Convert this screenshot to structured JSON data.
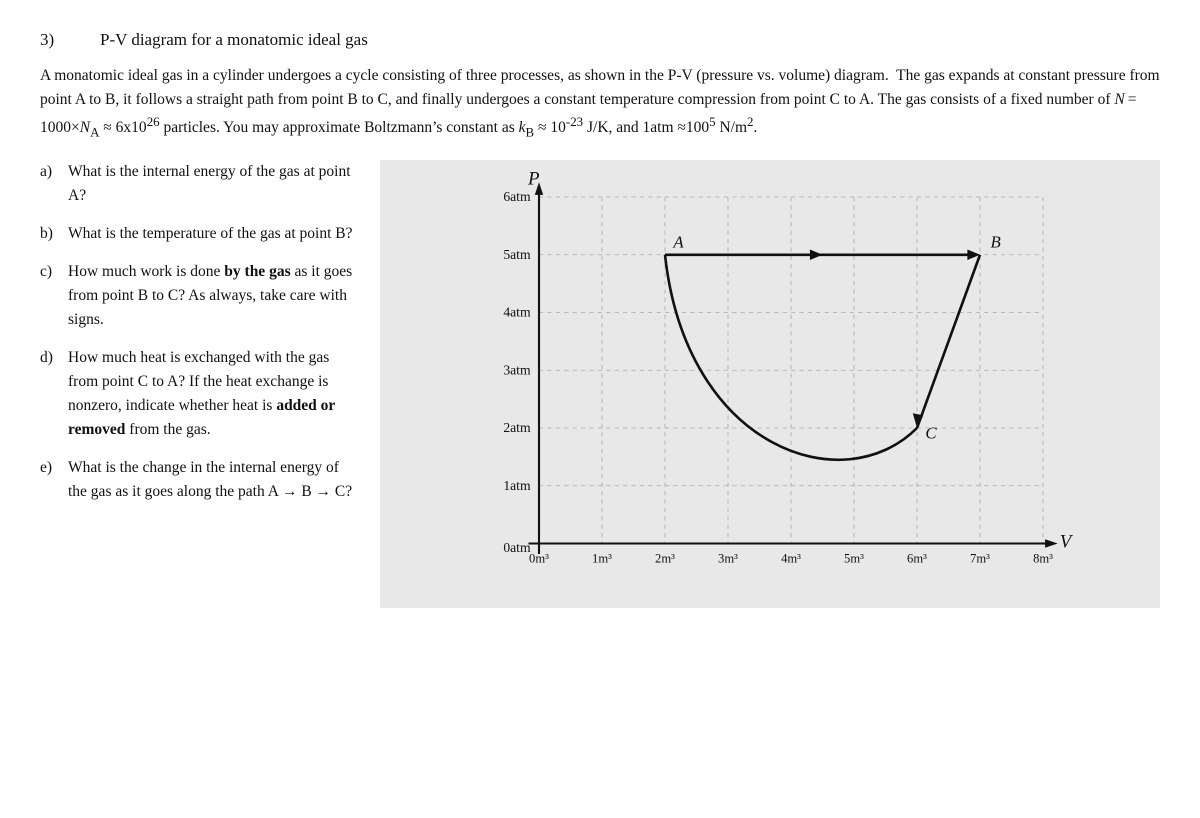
{
  "problem": {
    "number": "3)",
    "title": "P-V diagram for a monatomic ideal gas",
    "intro": "A monatomic ideal gas in a cylinder undergoes a cycle consisting of three processes, as shown in the P-V (pressure vs. volume) diagram.  The gas expands at constant pressure from point A to B, it follows a straight path from point B to C, and finally undergoes a constant temperature compression from point C to A. The gas consists of a fixed number of N = 1000×Nₐ ≈ 6x10²⁶ particles. You may approximate Boltzmann’s constant as kʙ ≈ 10⁻²³ J/K, and 1atm ≈100⁵ N/m².",
    "questions": [
      {
        "label": "a)",
        "text": "What is the internal energy of the gas at point A?"
      },
      {
        "label": "b)",
        "text": "What is the temperature of the gas at point B?"
      },
      {
        "label": "c)",
        "text": "How much work is done",
        "bold_part": "by the gas",
        "text2": "as it goes from point B to C? As always, take care with signs."
      },
      {
        "label": "d)",
        "text": "How much heat is exchanged with the gas from point C to A? If the heat exchange is nonzero, indicate whether heat is",
        "bold_part": "added or removed",
        "text2": "from the gas."
      },
      {
        "label": "e)",
        "text": "What is the change in the internal energy of the gas as it goes along the path A → B → C?"
      }
    ]
  }
}
